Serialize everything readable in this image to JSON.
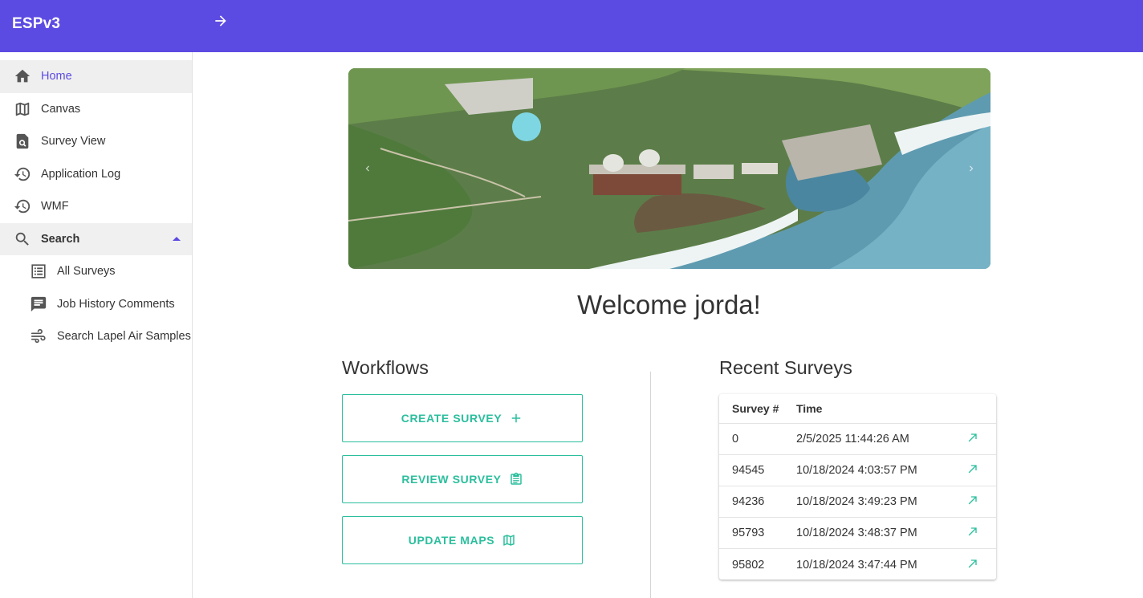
{
  "app": {
    "title": "ESPv3"
  },
  "topbar": {
    "expand_icon": "arrow-right-icon"
  },
  "sidebar": {
    "items": [
      {
        "label": "Home",
        "icon": "home-icon"
      },
      {
        "label": "Canvas",
        "icon": "map-icon"
      },
      {
        "label": "Survey View",
        "icon": "document-search-icon"
      },
      {
        "label": "Application Log",
        "icon": "history-icon"
      },
      {
        "label": "WMF",
        "icon": "history-icon"
      },
      {
        "label": "Search",
        "icon": "search-icon"
      }
    ],
    "subitems": [
      {
        "label": "All Surveys",
        "icon": "list-icon"
      },
      {
        "label": "Job History Comments",
        "icon": "comment-icon"
      },
      {
        "label": "Search Lapel Air Samples",
        "icon": "air-icon"
      }
    ]
  },
  "main": {
    "welcome": "Welcome jorda!",
    "workflows": {
      "title": "Workflows",
      "buttons": [
        {
          "label": "CREATE SURVEY",
          "icon": "plus-icon"
        },
        {
          "label": "REVIEW SURVEY",
          "icon": "clipboard-icon"
        },
        {
          "label": "UPDATE MAPS",
          "icon": "map-icon"
        }
      ]
    },
    "recent": {
      "title": "Recent Surveys",
      "columns": [
        "Survey #",
        "Time"
      ],
      "rows": [
        {
          "survey": "0",
          "time": "2/5/2025 11:44:26 AM"
        },
        {
          "survey": "94545",
          "time": "10/18/2024 4:03:57 PM"
        },
        {
          "survey": "94236",
          "time": "10/18/2024 3:49:23 PM"
        },
        {
          "survey": "95793",
          "time": "10/18/2024 3:48:37 PM"
        },
        {
          "survey": "95802",
          "time": "10/18/2024 3:47:44 PM"
        }
      ]
    }
  },
  "colors": {
    "brand": "#5c4be2",
    "accent": "#2bbf9d"
  }
}
